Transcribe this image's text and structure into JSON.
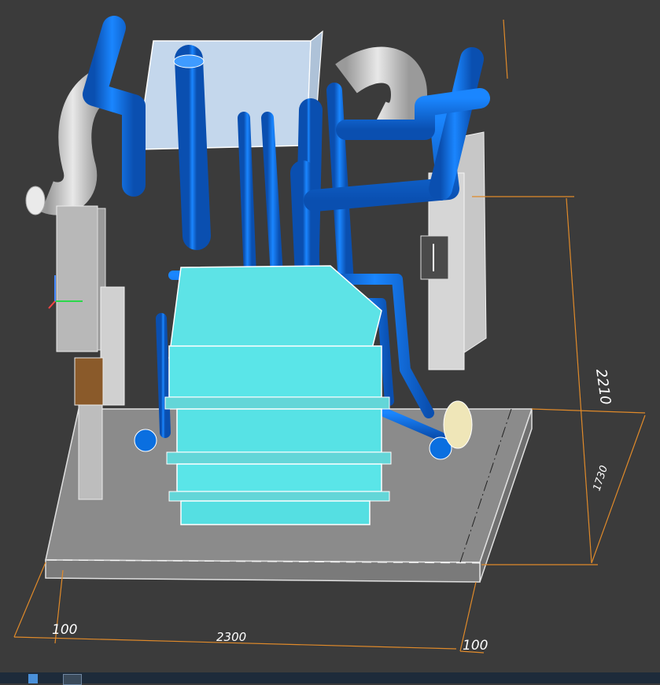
{
  "viewport": {
    "background": "#3b3b3b",
    "model": "3D assembly: tank unit with pipework on base frame"
  },
  "dimensions": {
    "height_total": "2210",
    "depth": "1730",
    "width": "2300",
    "offset_left": "100",
    "offset_right": "100"
  },
  "colors": {
    "pipe": "#0a6fe0",
    "tank": "#5ce6e8",
    "frame": "#dcdcdc",
    "base": "#8a8a8a",
    "dimension_line": "#e08a2a"
  },
  "taskbar": {
    "icons": [
      "folder-icon",
      "app-icon"
    ]
  }
}
